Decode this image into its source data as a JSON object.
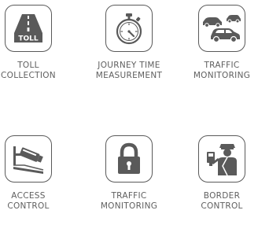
{
  "colors": {
    "icon": "#5a5a5a",
    "text": "#5f5f5f",
    "background": "#ffffff"
  },
  "tiles": [
    {
      "icon": "toll-road-icon",
      "icon_text": "TOLL",
      "line1": "TOLL",
      "line2": "COLLECTION"
    },
    {
      "icon": "stopwatch-icon",
      "line1": "JOURNEY TIME",
      "line2": "MEASUREMENT"
    },
    {
      "icon": "cars-icon",
      "line1": "TRAFFIC",
      "line2": "MONITORING"
    },
    {
      "icon": "security-camera-icon",
      "line1": "ACCESS",
      "line2": "CONTROL"
    },
    {
      "icon": "padlock-icon",
      "line1": "TRAFFIC",
      "line2": "MONITORING"
    },
    {
      "icon": "border-officer-icon",
      "line1": "BORDER",
      "line2": "CONTROL"
    }
  ]
}
